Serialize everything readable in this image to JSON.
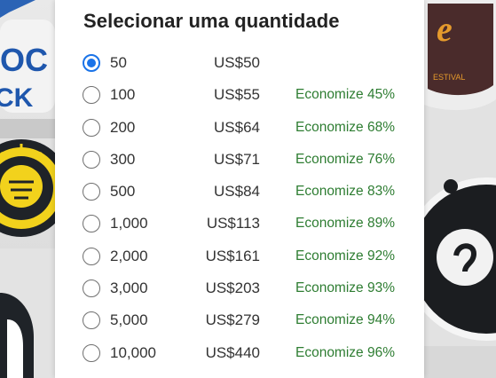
{
  "title": "Selecionar uma quantidade",
  "colors": {
    "accent": "#1a73e8",
    "savings": "#2e7d32",
    "text": "#333333",
    "title": "#222222"
  },
  "options": [
    {
      "qty": "50",
      "price": "US$50",
      "savings": "",
      "selected": true
    },
    {
      "qty": "100",
      "price": "US$55",
      "savings": "Economize 45%",
      "selected": false
    },
    {
      "qty": "200",
      "price": "US$64",
      "savings": "Economize 68%",
      "selected": false
    },
    {
      "qty": "300",
      "price": "US$71",
      "savings": "Economize 76%",
      "selected": false
    },
    {
      "qty": "500",
      "price": "US$84",
      "savings": "Economize 83%",
      "selected": false
    },
    {
      "qty": "1,000",
      "price": "US$113",
      "savings": "Economize 89%",
      "selected": false
    },
    {
      "qty": "2,000",
      "price": "US$161",
      "savings": "Economize 92%",
      "selected": false
    },
    {
      "qty": "3,000",
      "price": "US$203",
      "savings": "Economize 93%",
      "selected": false
    },
    {
      "qty": "5,000",
      "price": "US$279",
      "savings": "Economize 94%",
      "selected": false
    },
    {
      "qty": "10,000",
      "price": "US$440",
      "savings": "Economize 96%",
      "selected": false
    }
  ],
  "background": {
    "left_sticker_fragments": [
      "OC",
      "CK"
    ],
    "right_sticker_fragments": [
      "ESTIVAL"
    ]
  }
}
